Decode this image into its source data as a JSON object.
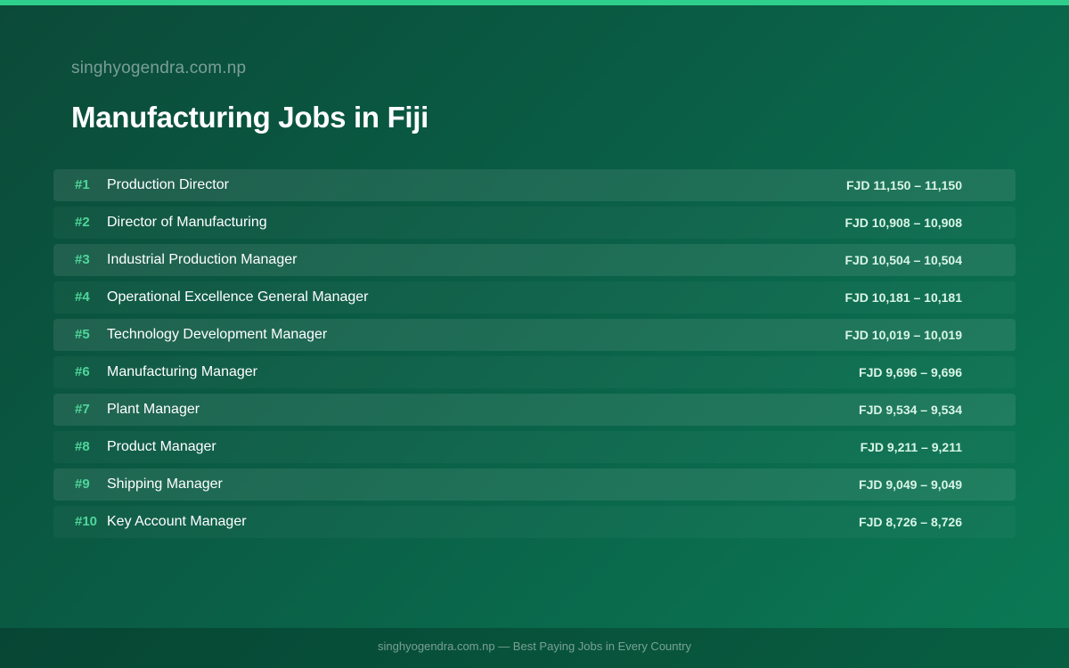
{
  "header": {
    "site": "singhyogendra.com.np",
    "title": "Manufacturing Jobs in Fiji"
  },
  "jobs": [
    {
      "rank": "#1",
      "title": "Production Director",
      "salary": "FJD 11,150 – 11,150"
    },
    {
      "rank": "#2",
      "title": "Director of Manufacturing",
      "salary": "FJD 10,908 – 10,908"
    },
    {
      "rank": "#3",
      "title": "Industrial Production Manager",
      "salary": "FJD 10,504 – 10,504"
    },
    {
      "rank": "#4",
      "title": "Operational Excellence General Manager",
      "salary": "FJD 10,181 – 10,181"
    },
    {
      "rank": "#5",
      "title": "Technology Development Manager",
      "salary": "FJD 10,019 – 10,019"
    },
    {
      "rank": "#6",
      "title": "Manufacturing Manager",
      "salary": "FJD 9,696 – 9,696"
    },
    {
      "rank": "#7",
      "title": "Plant Manager",
      "salary": "FJD 9,534 – 9,534"
    },
    {
      "rank": "#8",
      "title": "Product Manager",
      "salary": "FJD 9,211 – 9,211"
    },
    {
      "rank": "#9",
      "title": "Shipping Manager",
      "salary": "FJD 9,049 – 9,049"
    },
    {
      "rank": "#10",
      "title": "Key Account Manager",
      "salary": "FJD 8,726 – 8,726"
    }
  ],
  "footer": {
    "text": "singhyogendra.com.np — Best Paying Jobs in Every Country"
  },
  "colors": {
    "accent": "#2ecf8c",
    "rank": "#4fd69b",
    "background_start": "#0b4a38",
    "background_end": "#0b7a55"
  }
}
